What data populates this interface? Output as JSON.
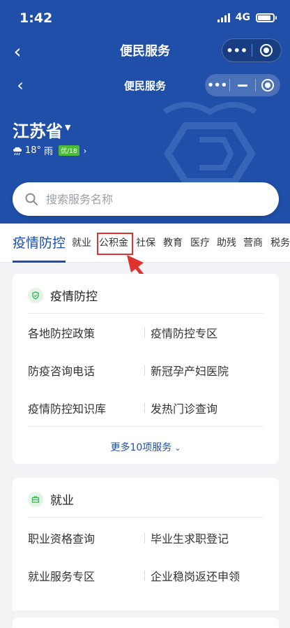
{
  "status_bar": {
    "time": "1:42",
    "network": "4G"
  },
  "nav_outer": {
    "title": "便民服务"
  },
  "nav_inner": {
    "title": "便民服务"
  },
  "location": {
    "province": "江苏省",
    "temperature": "18°",
    "weather": "雨",
    "aqi_badge": "优/18"
  },
  "search": {
    "placeholder": "搜索服务名称"
  },
  "tabs": [
    "疫情防控",
    "就业",
    "公积金",
    "社保",
    "教育",
    "医疗",
    "助残",
    "营商",
    "税务"
  ],
  "active_tab_index": 0,
  "highlighted_tab": "公积金",
  "cards": [
    {
      "title": "疫情防控",
      "services": [
        "各地防控政策",
        "疫情防控专区",
        "防疫咨询电话",
        "新冠孕产妇医院",
        "疫情防控知识库",
        "发热门诊查询"
      ],
      "more": "更多10项服务"
    },
    {
      "title": "就业",
      "services": [
        "职业资格查询",
        "毕业生求职登记",
        "就业服务专区",
        "企业稳岗返还申领"
      ]
    }
  ],
  "colors": {
    "primary": "#1f4fa8",
    "highlight": "#e0322f",
    "aqi_green": "#4cbb3a"
  },
  "icons": {
    "back": "chevron-left-icon",
    "more": "more-dots-icon",
    "close": "target-icon",
    "search": "search-icon",
    "weather": "rain-cloud-icon"
  }
}
